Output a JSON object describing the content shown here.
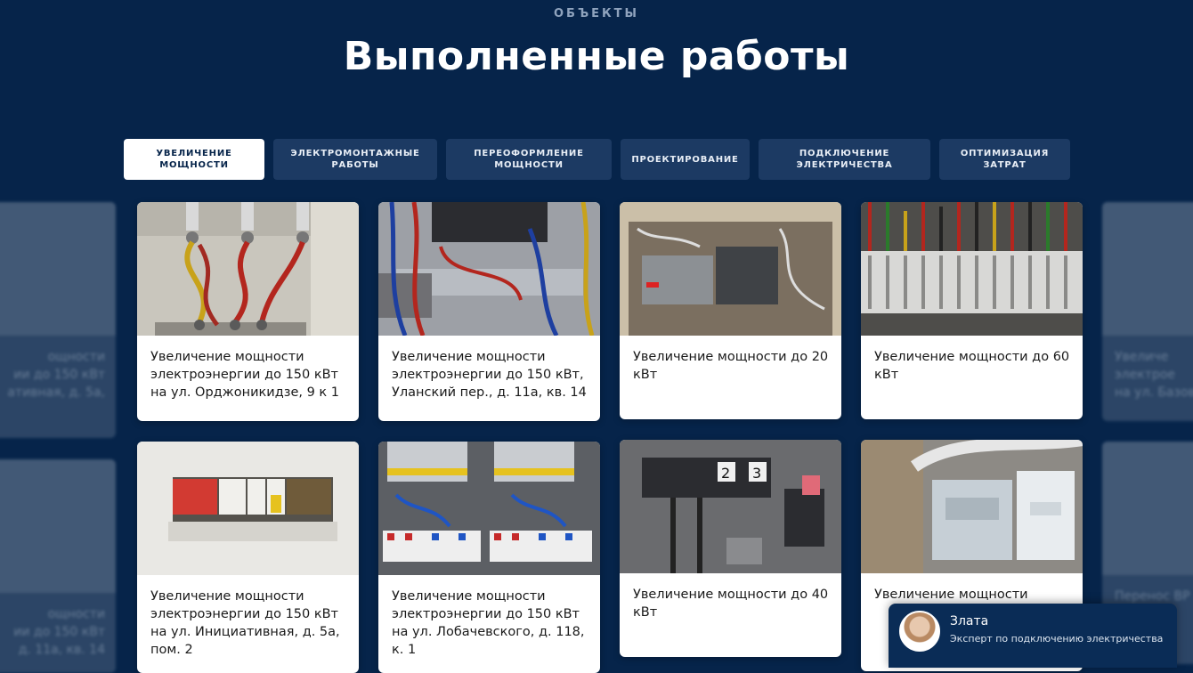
{
  "header": {
    "eyebrow": "ОБЪЕКТЫ",
    "title": "Выполненные работы"
  },
  "tabs": [
    {
      "label": "УВЕЛИЧЕНИЕ МОЩНОСТИ",
      "active": true
    },
    {
      "label": "ЭЛЕКТРОМОНТАЖНЫЕ РАБОТЫ",
      "active": false
    },
    {
      "label": "ПЕРЕОФОРМЛЕНИЕ МОЩНОСТИ",
      "active": false
    },
    {
      "label": "ПРОЕКТИРОВАНИЕ",
      "active": false
    },
    {
      "label": "ПОДКЛЮЧЕНИЕ ЭЛЕКТРИЧЕСТВА",
      "active": false
    },
    {
      "label": "ОПТИМИЗАЦИЯ ЗАТРАТ",
      "active": false
    }
  ],
  "cards": [
    {
      "caption": "Увеличение мощности электроэнергии до 150 кВт на ул. Орджоникидзе, 9 к 1"
    },
    {
      "caption": "Увеличение мощности электроэнергии до 150 кВт, Уланский пер., д. 11а, кв. 14"
    },
    {
      "caption": "Увеличение мощности до 20 кВт"
    },
    {
      "caption": "Увеличение мощности до 60 кВт"
    },
    {
      "caption": "Увеличение мощности электроэнергии до 150 кВт на ул. Инициативная, д. 5а, пом. 2"
    },
    {
      "caption": "Увеличение мощности электроэнергии до 150 кВт на ул. Лобачевского, д. 118, к. 1"
    },
    {
      "caption": "Увеличение мощности до 40 кВт"
    },
    {
      "caption": "Увеличение мощности"
    }
  ],
  "ghost_cards": {
    "left_top": [
      "ощности",
      "ии до 150 кВт",
      "ативная, д. 5а,"
    ],
    "left_bottom": [
      "ощности",
      "ии до 150 кВт",
      "д. 11а, кв. 14"
    ],
    "right_top": [
      "Увеличе",
      "электрое",
      "на ул. Базов"
    ],
    "right_bottom": [
      "Перенос ВР"
    ]
  },
  "chat_widget": {
    "name": "Злата",
    "role": "Эксперт по подключению электричества"
  }
}
